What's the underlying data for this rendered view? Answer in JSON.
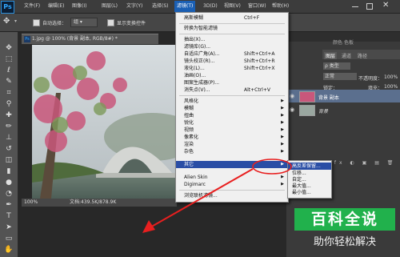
{
  "app": {
    "logo": "Ps"
  },
  "menubar": {
    "items": [
      "文件(F)",
      "编辑(E)",
      "图像(I)",
      "图层(L)",
      "文字(Y)",
      "选择(S)",
      "滤镜(T)",
      "3D(D)",
      "视图(V)",
      "窗口(W)",
      "帮助(H)"
    ],
    "active_index": 6
  },
  "options": {
    "auto_select_label": "自动选择：",
    "auto_select_value": "组",
    "show_transform_label": "显示变换控件"
  },
  "document": {
    "tab_title": "1.jpg @ 100% (背景 副本, RGB/8#) *",
    "zoom": "100%",
    "doc_info": "文档:439.5K/878.9K"
  },
  "panels": {
    "tabs": [
      "图层",
      "通道",
      "路径"
    ],
    "left_tabs": [
      "颜色",
      "色板"
    ],
    "kind_label": "ρ 类型",
    "blend_mode": "正常",
    "opacity_label": "不透明度：",
    "opacity_value": "100%",
    "lock_label": "锁定：",
    "fill_label": "填充：",
    "fill_value": "100%",
    "layers": [
      {
        "name": "背景 副本",
        "selected": true
      },
      {
        "name": "背景",
        "selected": false
      }
    ]
  },
  "filter_menu": {
    "top_items": [
      {
        "label": "高斯模糊",
        "shortcut": "Ctrl+F"
      },
      {
        "label": "转换为智能滤镜",
        "shortcut": ""
      }
    ],
    "mid_items": [
      {
        "label": "抽出(X)...",
        "shortcut": ""
      },
      {
        "label": "滤镜库(G)...",
        "shortcut": ""
      },
      {
        "label": "自适应广角(A)...",
        "shortcut": "Shift+Ctrl+A"
      },
      {
        "label": "镜头校正(R)...",
        "shortcut": "Shift+Ctrl+R"
      },
      {
        "label": "液化(L)...",
        "shortcut": "Shift+Ctrl+X"
      },
      {
        "label": "油画(O)...",
        "shortcut": ""
      },
      {
        "label": "图案生成器(P)...",
        "shortcut": ""
      },
      {
        "label": "消失点(V)...",
        "shortcut": "Alt+Ctrl+V"
      }
    ],
    "sub_items": [
      "风格化",
      "模糊",
      "扭曲",
      "锐化",
      "视频",
      "像素化",
      "渲染",
      "杂色",
      "其它",
      "Alien Skin",
      "Digimarc"
    ],
    "selected_sub_index": 8,
    "bottom_item": "浏览联机滤镜..."
  },
  "submenu": {
    "items": [
      "高反差保留...",
      "位移...",
      "自定...",
      "最大值...",
      "最小值..."
    ],
    "highlight_index": 0
  },
  "watermark": {
    "title": "百科全说",
    "subtitle": "助你轻松解决"
  },
  "colors": {
    "menu_highlight": "#2a4ea5",
    "arrow": "#e81f1f",
    "watermark_bg": "#21b14c"
  }
}
